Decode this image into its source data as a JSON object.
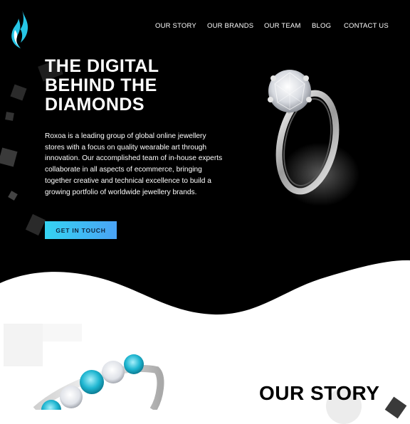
{
  "header": {
    "logo_icon": "flame-logo-icon",
    "nav": [
      "OUR STORY",
      "OUR BRANDS",
      "OUR TEAM",
      "BLOG",
      "CONTACT US"
    ]
  },
  "hero": {
    "title_lines": [
      "THE DIGITAL",
      "BEHIND THE",
      "DIAMONDS"
    ],
    "description": "Roxoa is a leading group of global online jewellery stores with a focus on quality wearable art through innovation. Our accomplished team of in-house experts collaborate in all aspects of ecommerce, bringing together creative and technical excellence to build a growing portfolio of worldwide jewellery brands.",
    "cta_label": "GET IN TOUCH",
    "image_icon": "diamond-ring-icon"
  },
  "story": {
    "title": "OUR STORY",
    "image_icon": "gemstone-ring-icon"
  },
  "colors": {
    "background": "#000000",
    "accent": "#35d3f2",
    "text": "#ffffff"
  }
}
